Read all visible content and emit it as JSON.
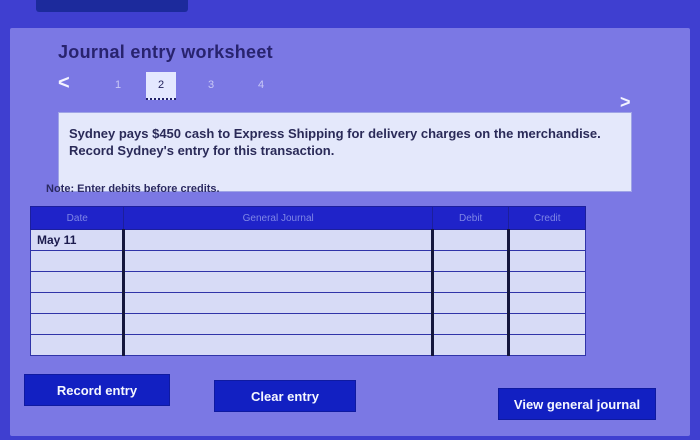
{
  "top_tab": {
    "label": ""
  },
  "worksheet": {
    "title": "Journal entry worksheet"
  },
  "steps": {
    "prev": "<",
    "next": ">",
    "items": [
      "1",
      "2",
      "3",
      "4"
    ],
    "active": "2"
  },
  "question": {
    "text": "Sydney pays $450 cash to Express Shipping for delivery charges on the merchandise. Record Sydney's entry for this transaction."
  },
  "note": "Note: Enter debits before credits.",
  "table": {
    "headers": {
      "date": "Date",
      "account": "General Journal",
      "debit": "Debit",
      "credit": "Credit"
    },
    "rows": [
      {
        "date": "May 11",
        "account": "",
        "debit": "",
        "credit": ""
      },
      {
        "date": "",
        "account": "",
        "debit": "",
        "credit": ""
      },
      {
        "date": "",
        "account": "",
        "debit": "",
        "credit": ""
      },
      {
        "date": "",
        "account": "",
        "debit": "",
        "credit": ""
      },
      {
        "date": "",
        "account": "",
        "debit": "",
        "credit": ""
      },
      {
        "date": "",
        "account": "",
        "debit": "",
        "credit": ""
      }
    ]
  },
  "buttons": {
    "record": "Record entry",
    "clear": "Clear entry",
    "view": "View general journal"
  }
}
